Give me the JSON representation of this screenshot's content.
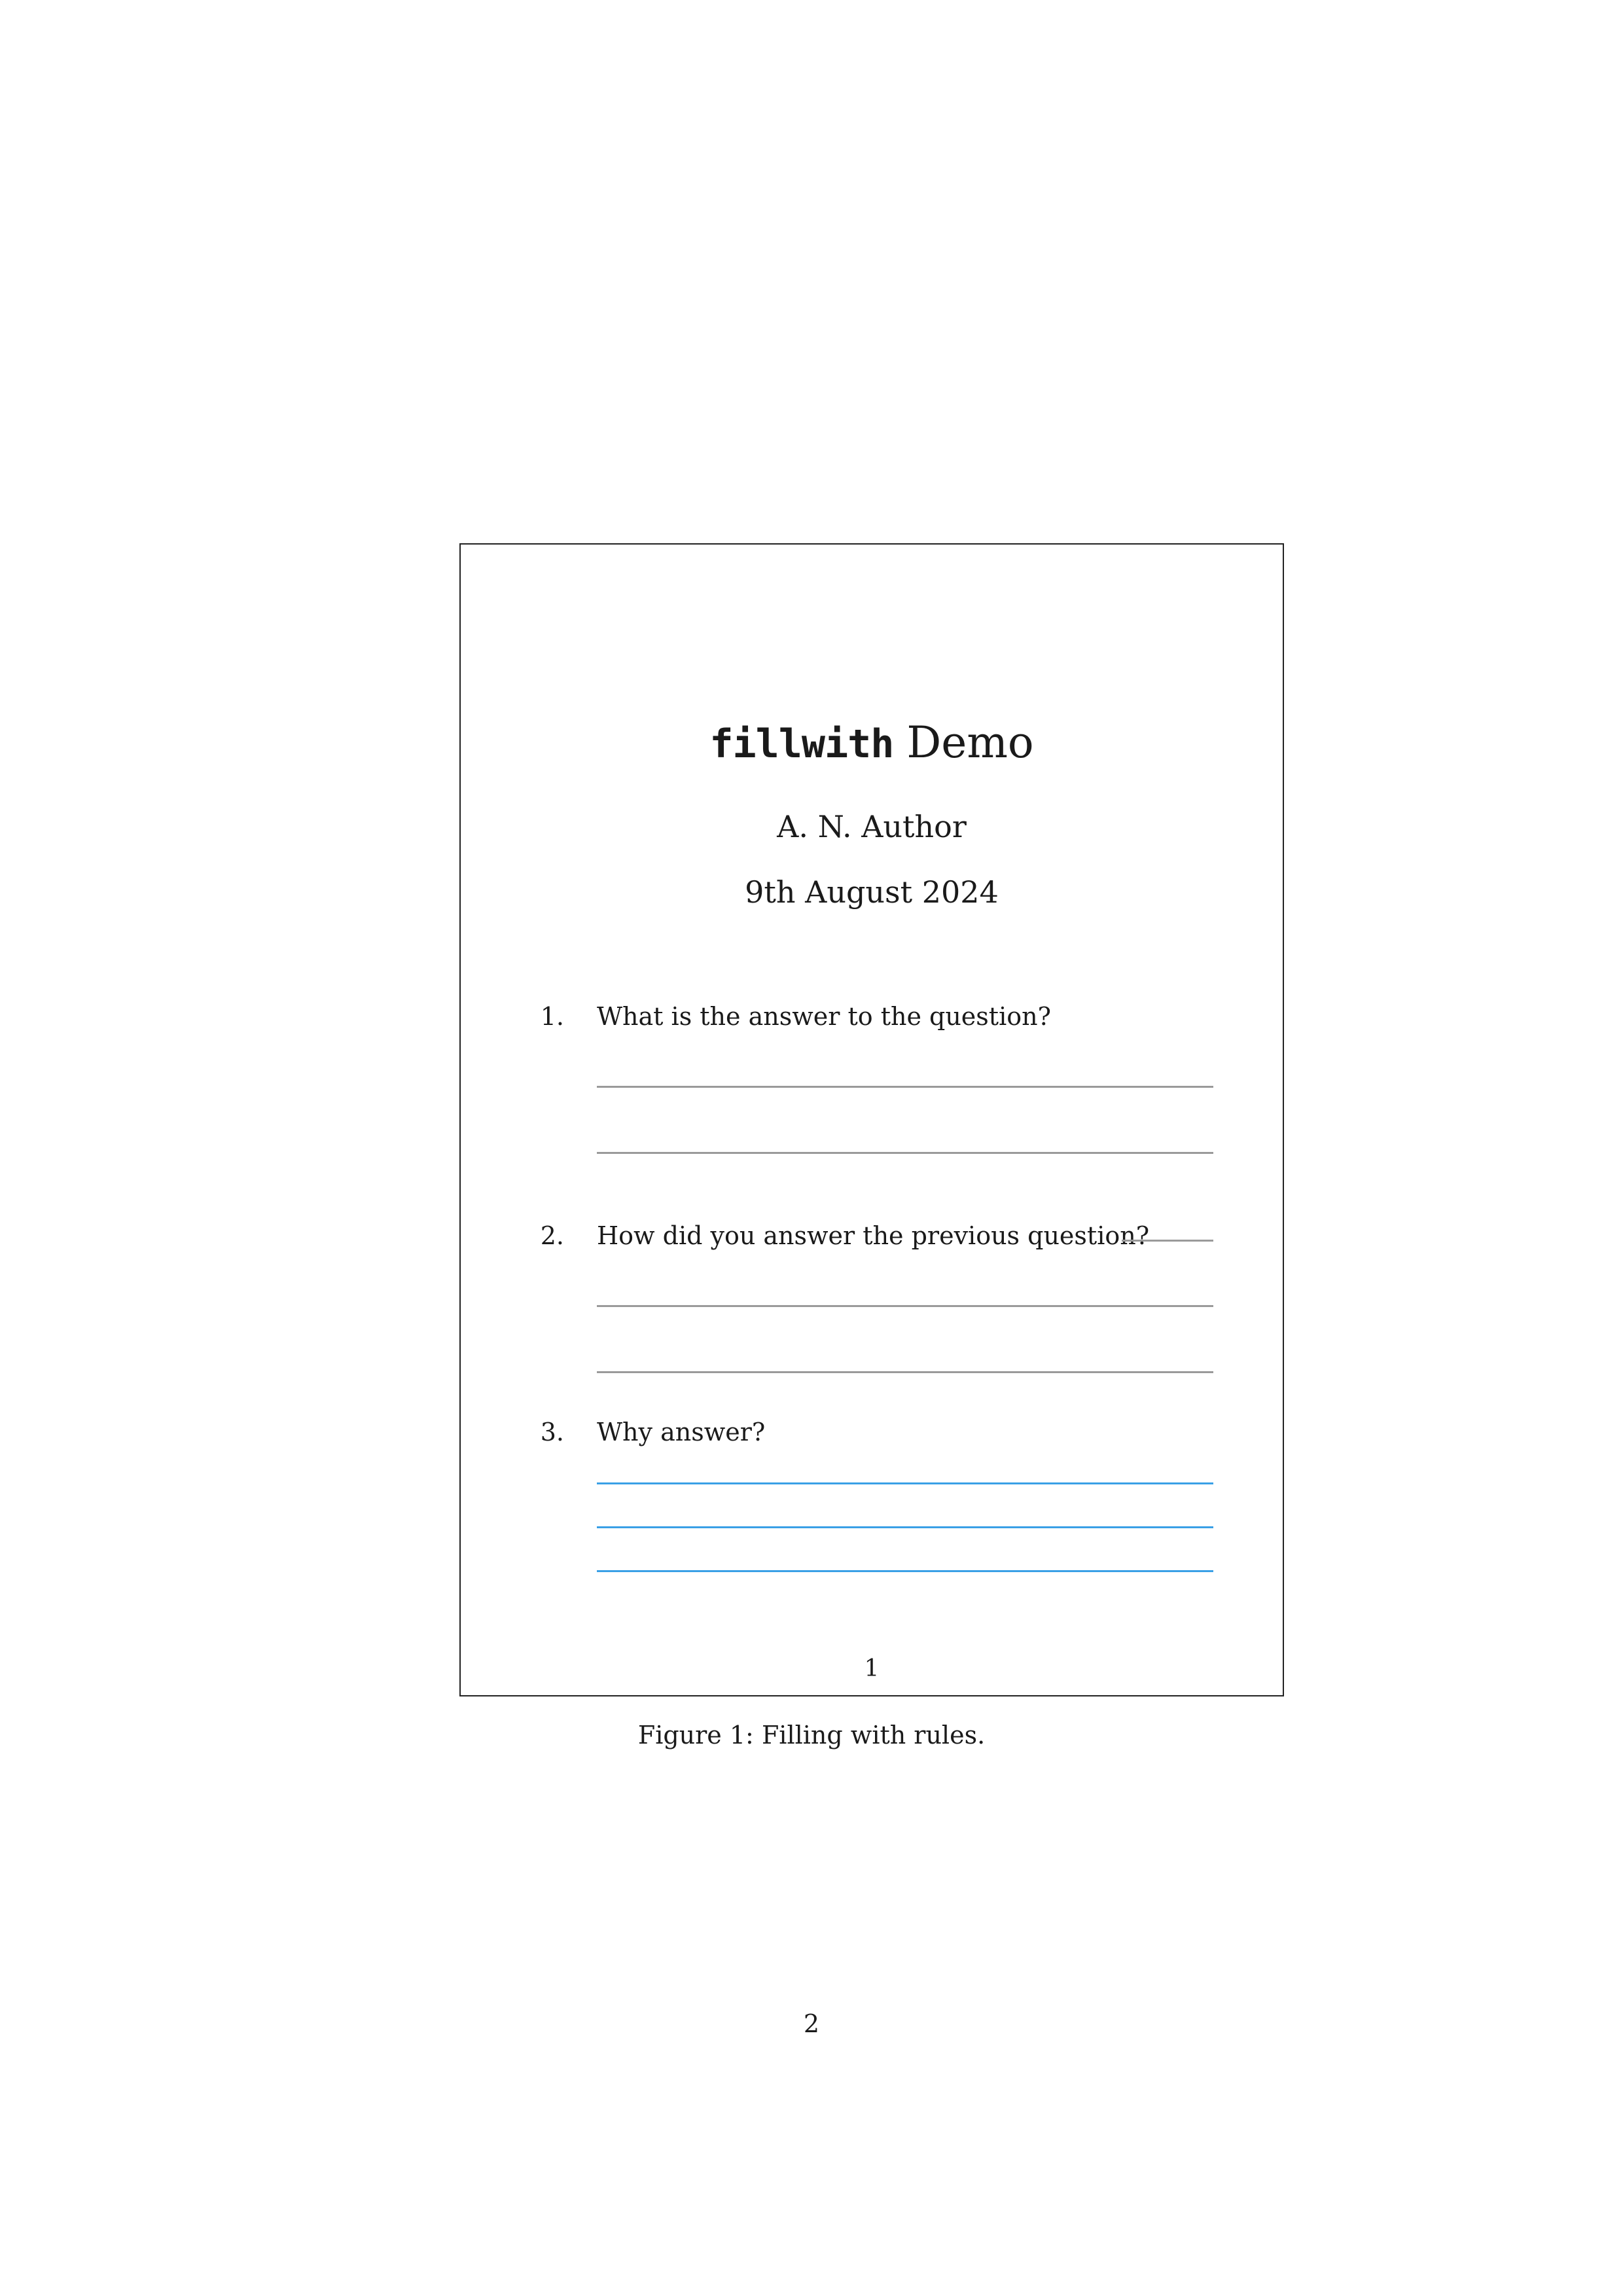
{
  "figure": {
    "title_code": "fillwith",
    "title_rest": "Demo",
    "author": "A. N. Author",
    "date": "9th August 2024",
    "questions": [
      {
        "number": "1.",
        "text": "What is the answer to the question?"
      },
      {
        "number": "2.",
        "text": "How did you answer the previous question?"
      },
      {
        "number": "3.",
        "text": "Why answer?"
      }
    ],
    "page_number": "1",
    "colors": {
      "grey_rule": "#9a9a9a",
      "blue_rule": "#3aa0e6"
    }
  },
  "caption": "Figure 1: Filling with rules.",
  "page_number": "2"
}
